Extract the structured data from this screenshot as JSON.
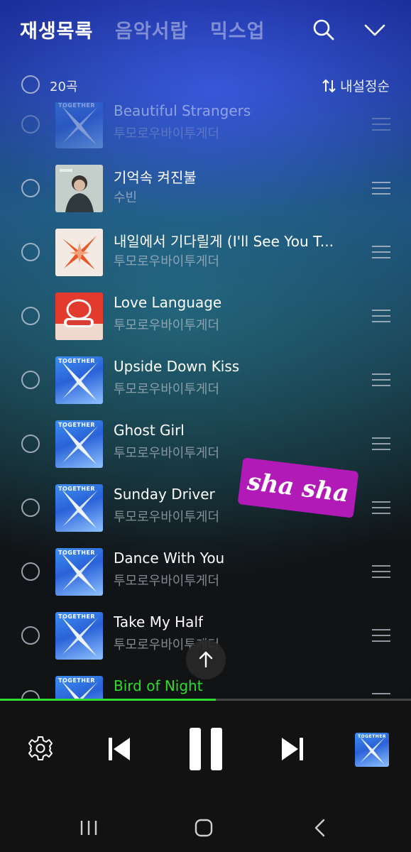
{
  "header": {
    "tabs": [
      {
        "label": "재생목록",
        "active": true
      },
      {
        "label": "음악서랍",
        "active": false
      },
      {
        "label": "믹스업",
        "active": false
      }
    ]
  },
  "selection": {
    "count_label": "20곡",
    "sort_label": "내설정순"
  },
  "tracks": [
    {
      "title": "Beautiful Strangers",
      "artist": "투모로우바이투게더",
      "cover": "together-icon",
      "state": "faded"
    },
    {
      "title": "기억속 켜진불",
      "artist": "수빈",
      "cover": "portrait-icon",
      "state": "normal"
    },
    {
      "title": "내일에서 기다릴게 (I'll See You T...",
      "artist": "투모로우바이투게더",
      "cover": "orange-star-icon",
      "state": "normal"
    },
    {
      "title": "Love Language",
      "artist": "투모로우바이투게더",
      "cover": "ring-box-icon",
      "state": "normal"
    },
    {
      "title": "Upside Down Kiss",
      "artist": "투모로우바이투게더",
      "cover": "together-icon",
      "state": "normal"
    },
    {
      "title": "Ghost Girl",
      "artist": "투모로우바이투게더",
      "cover": "together-icon",
      "state": "normal"
    },
    {
      "title": "Sunday Driver",
      "artist": "투모로우바이투게더",
      "cover": "together-icon",
      "state": "normal"
    },
    {
      "title": "Dance With You",
      "artist": "투모로우바이투게더",
      "cover": "together-icon",
      "state": "normal"
    },
    {
      "title": "Take My Half",
      "artist": "투모로우바이투게더",
      "cover": "together-icon",
      "state": "normal"
    },
    {
      "title": "Bird of Night",
      "artist": "",
      "cover": "together-icon",
      "state": "playing"
    }
  ],
  "cover_text": "TOGETHER",
  "sticker": {
    "text": "sha sha",
    "color": "#b21ab7"
  },
  "player": {
    "progress_fraction": 0.525,
    "accent": "#2ddc2d",
    "controls": [
      "gear-icon",
      "previous-icon",
      "pause-icon",
      "next-icon",
      "album-thumbnail"
    ]
  },
  "system_nav": [
    "recent-apps-icon",
    "home-icon",
    "back-icon"
  ]
}
